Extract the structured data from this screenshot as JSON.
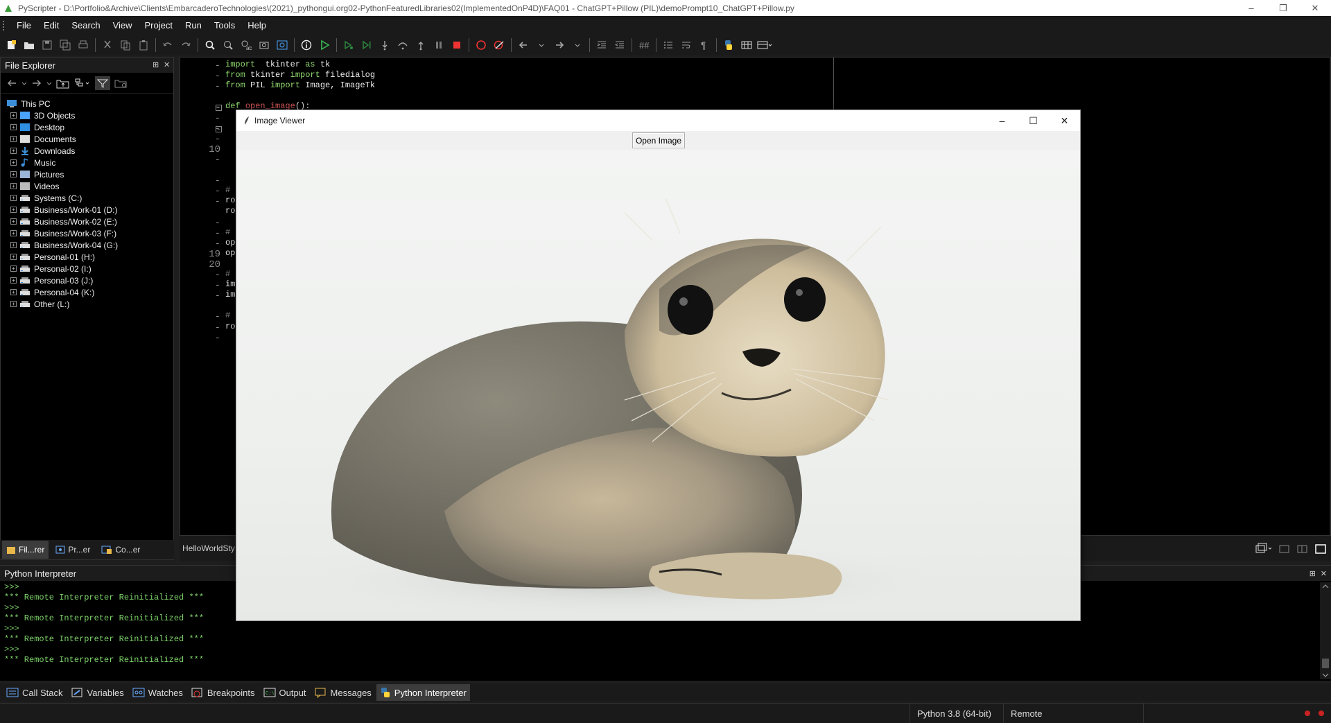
{
  "window": {
    "title": "PyScripter - D:\\Portfolio&Archive\\Clients\\EmbarcaderoTechnologies\\(2021)_pythongui.org02-PythonFeaturedLibraries02(ImplementedOnP4D)\\FAQ01 - ChatGPT+Pillow (PIL)\\demoPrompt10_ChatGPT+Pillow.py",
    "controls": [
      "–",
      "❐",
      "✕"
    ]
  },
  "menu": [
    "File",
    "Edit",
    "Search",
    "View",
    "Project",
    "Run",
    "Tools",
    "Help"
  ],
  "file_explorer": {
    "title": "File Explorer",
    "root": "This PC",
    "items": [
      {
        "label": "3D Objects",
        "icon": "3d-objects-icon"
      },
      {
        "label": "Desktop",
        "icon": "desktop-icon"
      },
      {
        "label": "Documents",
        "icon": "documents-icon"
      },
      {
        "label": "Downloads",
        "icon": "downloads-icon"
      },
      {
        "label": "Music",
        "icon": "music-icon"
      },
      {
        "label": "Pictures",
        "icon": "pictures-icon"
      },
      {
        "label": "Videos",
        "icon": "videos-icon"
      },
      {
        "label": "Systems (C:)",
        "icon": "drive-icon"
      },
      {
        "label": "Business/Work-01 (D:)",
        "icon": "drive-icon"
      },
      {
        "label": "Business/Work-02 (E:)",
        "icon": "drive-icon"
      },
      {
        "label": "Business/Work-03 (F:)",
        "icon": "drive-icon"
      },
      {
        "label": "Business/Work-04 (G:)",
        "icon": "drive-icon"
      },
      {
        "label": "Personal-01 (H:)",
        "icon": "drive-icon"
      },
      {
        "label": "Personal-02 (I:)",
        "icon": "drive-icon"
      },
      {
        "label": "Personal-03 (J:)",
        "icon": "drive-icon"
      },
      {
        "label": "Personal-04 (K:)",
        "icon": "drive-icon"
      },
      {
        "label": "Other (L:)",
        "icon": "drive-icon"
      }
    ]
  },
  "side_tabs": [
    "Fil...rer",
    "Pr...er",
    "Co...er"
  ],
  "editor": {
    "gutter": [
      "-",
      "-",
      "-",
      "",
      "-",
      "-",
      "-",
      "-",
      "10",
      "-",
      "",
      "-",
      "-",
      "-",
      "",
      "-",
      "-",
      "-",
      "19",
      "20",
      "-",
      "-",
      "-",
      "",
      "-",
      "-",
      "-"
    ],
    "code": [
      {
        "parts": [
          [
            "kw",
            "import"
          ],
          [
            "",
            "  tkinter "
          ],
          [
            "kw",
            "as"
          ],
          [
            "",
            " tk"
          ]
        ]
      },
      {
        "parts": [
          [
            "kw",
            "from"
          ],
          [
            "",
            " tkinter "
          ],
          [
            "kw",
            "import"
          ],
          [
            "",
            " filedialog"
          ]
        ]
      },
      {
        "parts": [
          [
            "kw",
            "from"
          ],
          [
            "",
            " PIL "
          ],
          [
            "kw",
            "import"
          ],
          [
            "",
            " Image, ImageTk"
          ]
        ]
      },
      {
        "parts": [
          [
            "",
            ""
          ]
        ]
      },
      {
        "parts": [
          [
            "kw",
            "def"
          ],
          [
            "",
            " "
          ],
          [
            "kw2",
            "open_image"
          ],
          [
            "",
            "():"
          ]
        ]
      }
    ],
    "partial_lines": [
      "# C",
      "roo",
      "roo",
      "# C",
      "ope",
      "ope",
      "# C",
      "ima",
      "ima",
      "# R",
      "roo"
    ],
    "tab_label": "HelloWorldSty"
  },
  "interpreter": {
    "title": "Python Interpreter",
    "lines": [
      ">>>",
      "*** Remote Interpreter Reinitialized ***",
      ">>>",
      "*** Remote Interpreter Reinitialized ***",
      ">>>",
      "*** Remote Interpreter Reinitialized ***",
      ">>>",
      "*** Remote Interpreter Reinitialized ***"
    ]
  },
  "bottom_tabs": [
    "Call Stack",
    "Variables",
    "Watches",
    "Breakpoints",
    "Output",
    "Messages",
    "Python Interpreter"
  ],
  "status": {
    "python_version": "Python 3.8 (64-bit)",
    "mode": "Remote"
  },
  "image_viewer": {
    "title": "Image Viewer",
    "open_button": "Open Image",
    "controls": [
      "–",
      "☐",
      "✕"
    ],
    "image_subject": "harbor seal pup photo"
  },
  "colors": {
    "code_keyword": "#8fd96f",
    "code_function": "#e85f5f",
    "interpreter_text": "#7ed46a",
    "background": "#000000"
  }
}
